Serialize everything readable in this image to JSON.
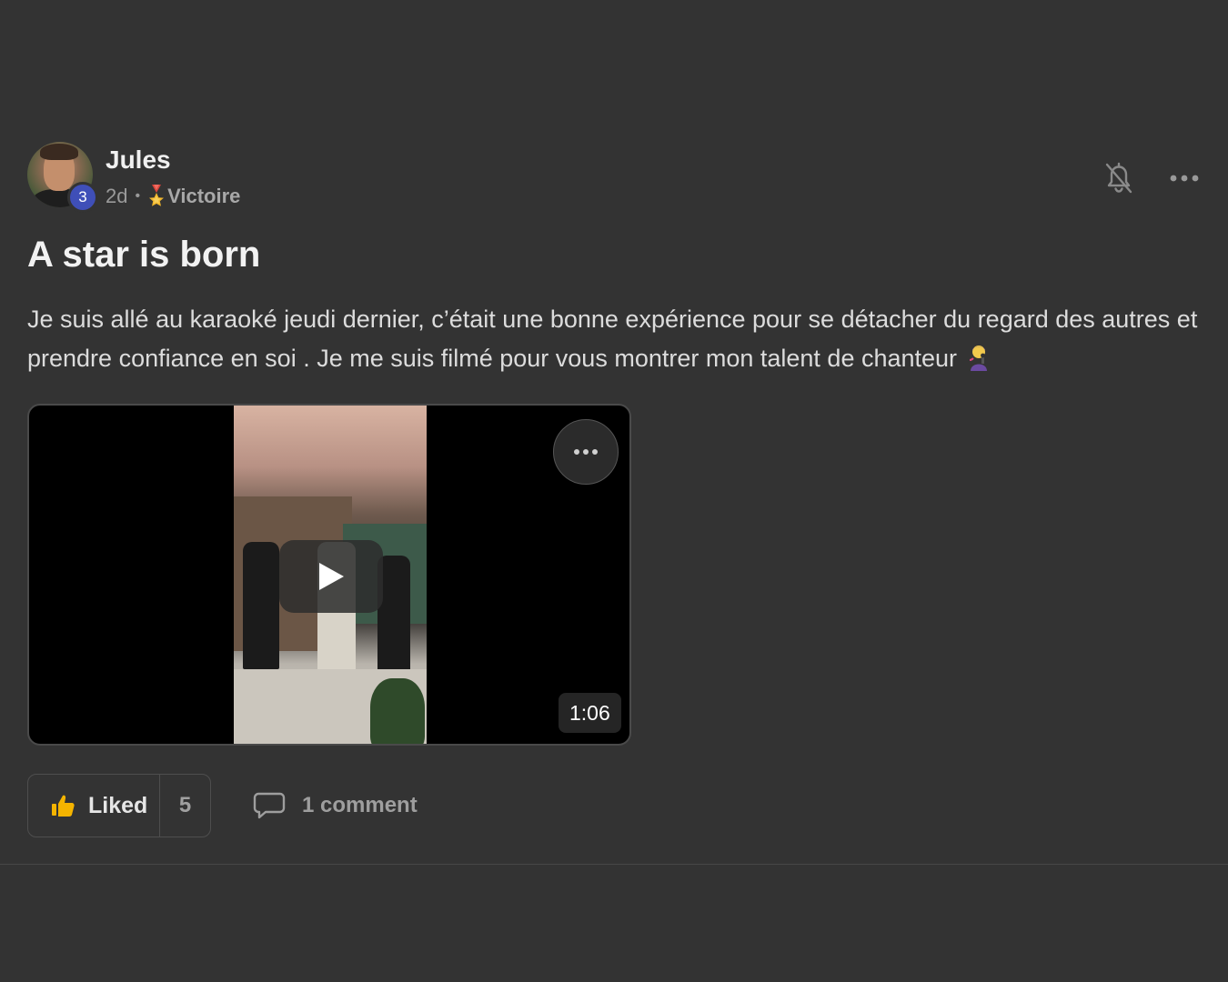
{
  "post": {
    "author": {
      "name": "Jules ",
      "level": "3",
      "avatar_icon": "avatar-photo"
    },
    "meta": {
      "time": "2d",
      "separator": "•",
      "category": "Victoire",
      "category_icon": "medal-icon"
    },
    "title": "A star is born",
    "body_text": "Je suis allé au karaoké jeudi dernier, c’était une bonne expérience pour se détacher du regard des autres et prendre confiance en soi . Je me suis filmé pour vous montrer mon talent de chanteur",
    "body_emoji": "singer-emoji",
    "video": {
      "duration": "1:06",
      "play_icon": "play-icon",
      "more_icon": "more-horizontal-icon"
    },
    "actions": {
      "like_label": "Liked",
      "like_count": "5",
      "comment_label": "1 comment"
    },
    "header_icons": [
      "bell-off-icon",
      "more-horizontal-icon"
    ]
  },
  "colors": {
    "background": "#333333",
    "level_badge": "#3f4fb8",
    "like_icon": "#f5b400"
  }
}
